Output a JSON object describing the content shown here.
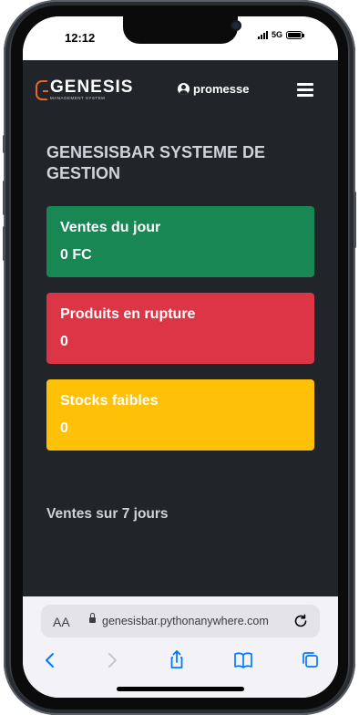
{
  "status_bar": {
    "time": "12:12",
    "network": "5G"
  },
  "app": {
    "brand": {
      "name": "GENESIS",
      "subtitle": "MANAGEMENT SYSTEM"
    },
    "user": {
      "name": "promesse"
    },
    "page_title": "GENESISBAR SYSTEME DE GESTION",
    "cards": [
      {
        "label": "Ventes du jour",
        "value": "0 FC",
        "color": "#198754"
      },
      {
        "label": "Produits en rupture",
        "value": "0",
        "color": "#dc3545"
      },
      {
        "label": "Stocks faibles",
        "value": "0",
        "color": "#ffc107"
      }
    ],
    "chart_section_title": "Ventes sur 7 jours",
    "colors": {
      "background": "#212529",
      "title_text": "#ced4da",
      "brand_accent": "#e8652a"
    }
  },
  "browser": {
    "text_size_label": "AA",
    "url": "genesisbar.pythonanywhere.com",
    "accent": "#007aff",
    "icons": [
      "back-icon",
      "forward-icon",
      "share-icon",
      "bookmarks-icon",
      "tabs-icon",
      "reload-icon",
      "lock-icon"
    ]
  }
}
